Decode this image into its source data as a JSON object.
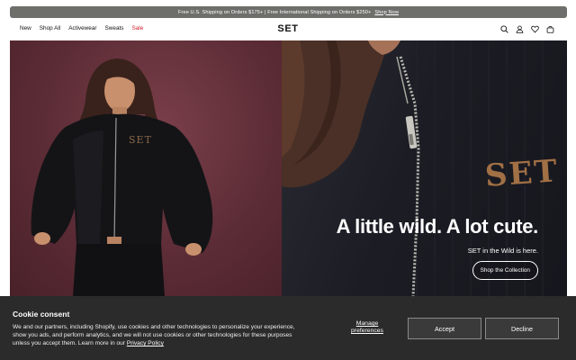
{
  "promo": {
    "text": "Free U.S. Shipping on Orders $175+ | Free International Shipping on Orders $250+",
    "link": "Shop Now"
  },
  "nav": {
    "items": [
      {
        "label": "New"
      },
      {
        "label": "Shop All"
      },
      {
        "label": "Activewear"
      },
      {
        "label": "Sweats"
      },
      {
        "label": "Sale"
      }
    ],
    "sale_color": "#d0202e"
  },
  "logo": "SET",
  "header_icons": [
    "search-icon",
    "account-icon",
    "wishlist-icon",
    "cart-icon"
  ],
  "hero": {
    "jacket_text": "SET",
    "headline": "A little wild. A lot cute.",
    "subtext": "SET in the Wild is here.",
    "cta": "Shop the Collection"
  },
  "cookie": {
    "title": "Cookie consent",
    "body": "We and our partners, including Shopify, use cookies and other technologies to personalize your experience, show you ads, and perform analytics, and we will not use cookies or other technologies for these purposes unless you accept them. Learn more in our ",
    "policy_link": "Privacy Policy",
    "manage": "Manage preferences",
    "accept": "Accept",
    "decline": "Decline"
  },
  "colors": {
    "promo_bg": "#6e6e6a",
    "hero_left_bg": "#5c2c36",
    "hero_right_bg": "#1c1c24",
    "cookie_bg": "#2b2b2b"
  }
}
